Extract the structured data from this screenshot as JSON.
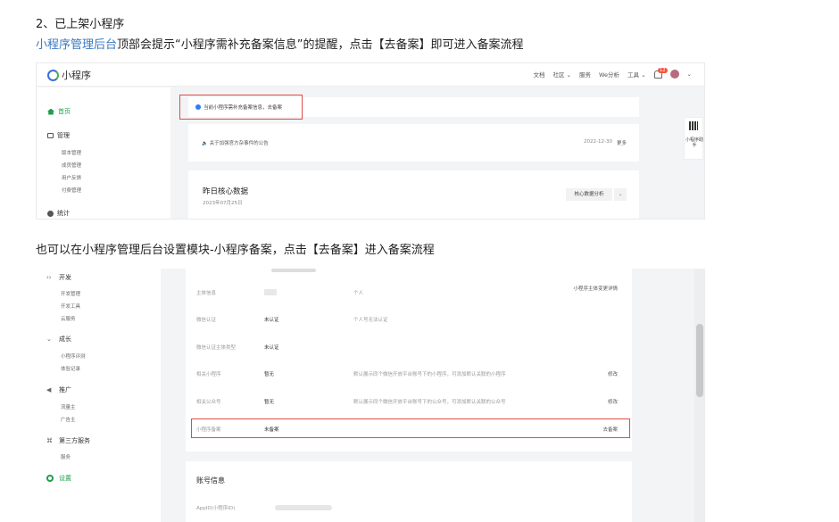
{
  "doc": {
    "step_title": "2、已上架小程序",
    "step_link": "小程序管理后台",
    "step_desc_rest": "顶部会提示“小程序需补充备案信息”的提醒，点击【去备案】即可进入备案流程",
    "para2": "也可以在小程序管理后台设置模块-小程序备案，点击【去备案】进入备案流程"
  },
  "shot1": {
    "app_title": "小程序",
    "nav": [
      "文档",
      "社区",
      "服务",
      "We分析",
      "工具"
    ],
    "bell_badge": "12",
    "sidebar": {
      "home": "首页",
      "manage": "管理",
      "manage_items": [
        "版本管理",
        "成员管理",
        "用户反馈",
        "付费管理"
      ],
      "stats": "统计"
    },
    "notice": "当前小程序需补充备案信息，去备案",
    "announcement": "关于加强官方杂事件的公告",
    "announcement_date": "2022-12-30",
    "announcement_more": "更多",
    "core_title": "昨日核心数据",
    "core_date": "2023年07月25日",
    "core_button": "核心数据分析",
    "side_card": "小程序助手"
  },
  "shot2": {
    "sidebar": {
      "dev": "开发",
      "dev_items": [
        "开发管理",
        "开发工具",
        "云服务"
      ],
      "growth": "成长",
      "growth_items": [
        "小程序评测",
        "体验记录"
      ],
      "promo": "推广",
      "promo_items": [
        "流量主",
        "广告主"
      ],
      "third": "第三方服务",
      "third_items": [
        "服务"
      ],
      "settings": "设置"
    },
    "rows": [
      {
        "label": "主体信息",
        "value": "",
        "desc": "个人",
        "action": "小程序主体变更详情"
      },
      {
        "label": "微信认证",
        "value": "未认证",
        "desc": "个人号无法认证",
        "action": ""
      },
      {
        "label": "微信认证主体类型",
        "value": "未认证",
        "desc": "",
        "action": ""
      },
      {
        "label": "相关小程序",
        "value": "暂无",
        "desc": "默认展示同个微信开放平台账号下的小程序，可添加默认关联的小程序",
        "action": "修改"
      },
      {
        "label": "相关公众号",
        "value": "暂无",
        "desc": "默认展示同个微信开放平台账号下的公众号，可添加默认关联的公众号",
        "action": "修改"
      },
      {
        "label": "小程序备案",
        "value": "未备案",
        "desc": "",
        "action": "去备案"
      }
    ],
    "account_title": "账号信息",
    "account_row_label": "AppID(小程序ID)"
  }
}
